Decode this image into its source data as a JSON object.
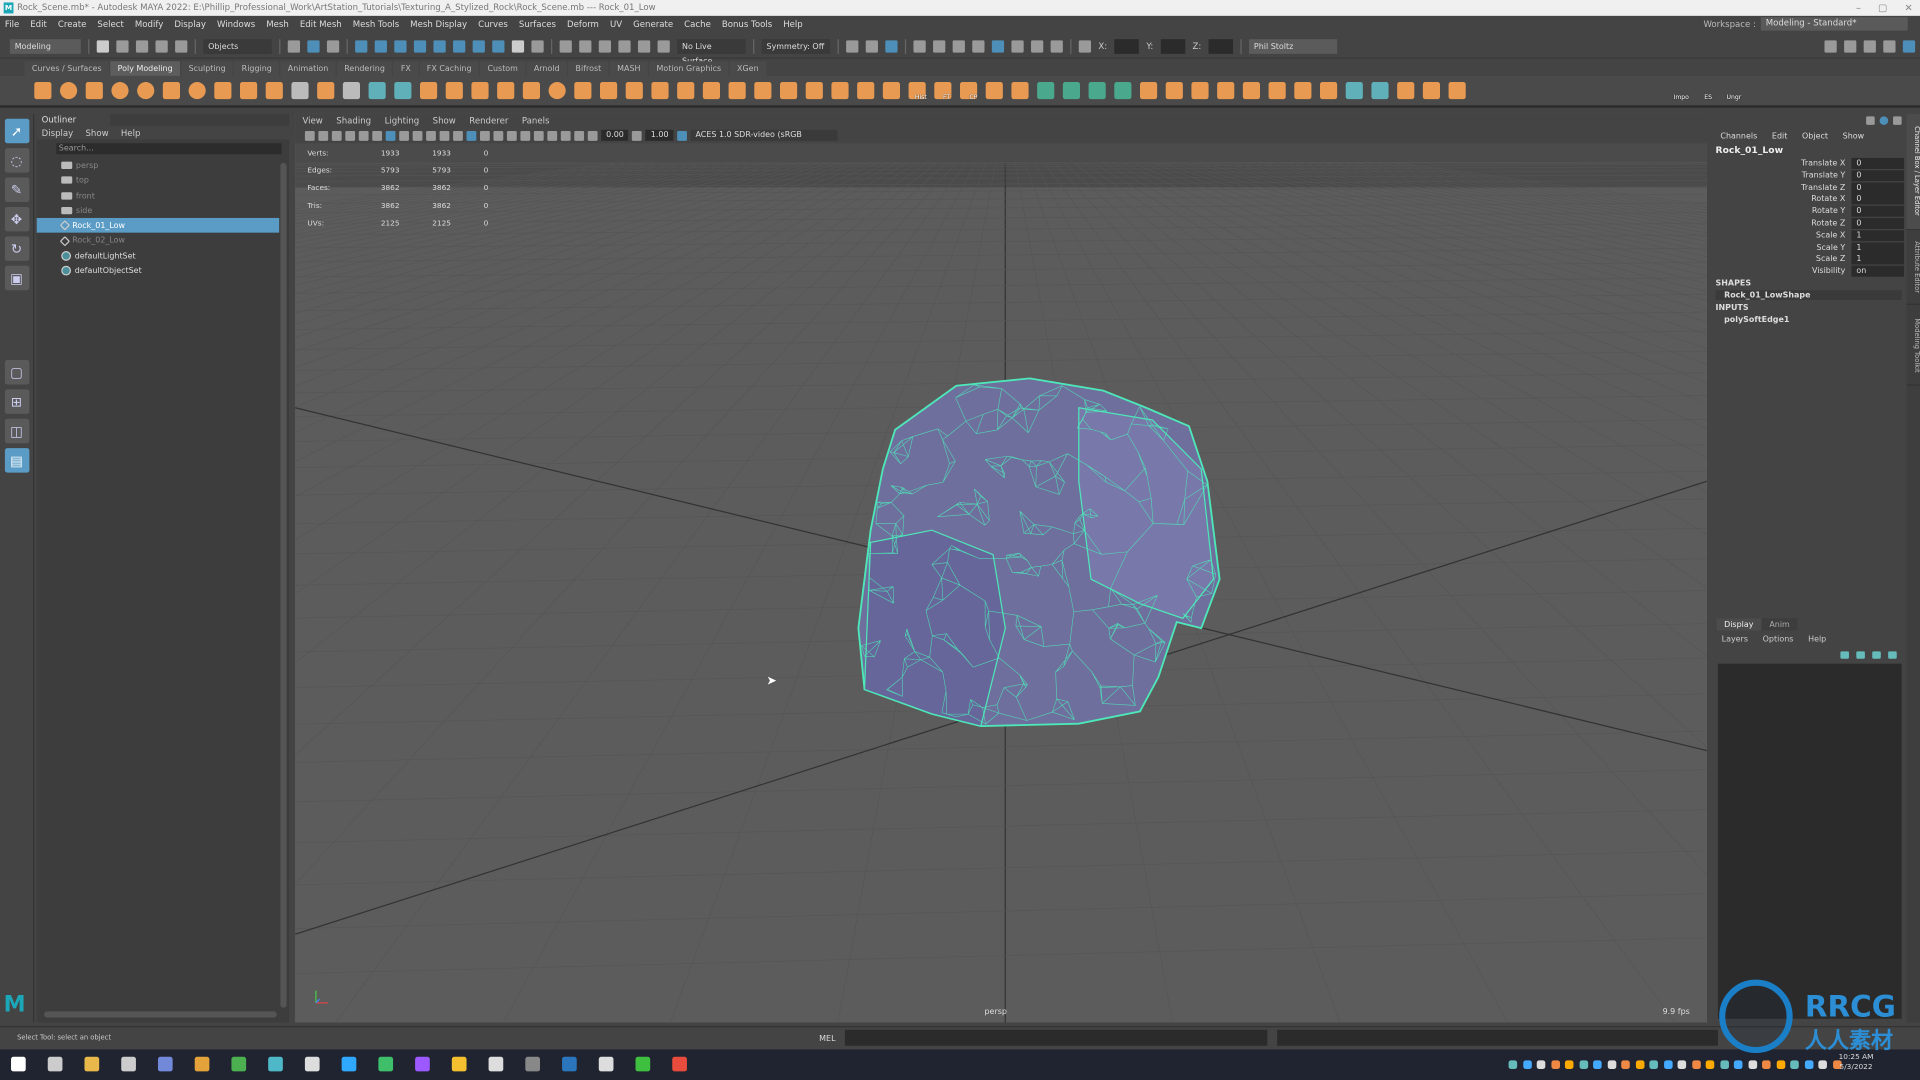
{
  "titlebar": {
    "text": "Rock_Scene.mb* - Autodesk MAYA 2022: E:\\Phillip_Professional_Work\\ArtStation_Tutorials\\Texturing_A_Stylized_Rock\\Rock_Scene.mb  ---  Rock_01_Low",
    "logo": "M",
    "controls": [
      "–",
      "▢",
      "✕"
    ]
  },
  "menubar": [
    "File",
    "Edit",
    "Create",
    "Select",
    "Modify",
    "Display",
    "Windows",
    "Mesh",
    "Edit Mesh",
    "Mesh Tools",
    "Mesh Display",
    "Curves",
    "Surfaces",
    "Deform",
    "UV",
    "Generate",
    "Cache",
    "Bonus Tools",
    "Help"
  ],
  "workspace": {
    "label": "Workspace :",
    "value": "Modeling - Standard*"
  },
  "statusline": {
    "menuset": "Modeling",
    "select_mode": "Objects",
    "live_surface": "No Live Surface",
    "symmetry": "Symmetry: Off",
    "x_label": "X:",
    "y_label": "Y:",
    "z_label": "Z:",
    "user": "Phil Stoltz"
  },
  "shelf": {
    "tabs": [
      "Curves / Surfaces",
      "Poly Modeling",
      "Sculpting",
      "Rigging",
      "Animation",
      "Rendering",
      "FX",
      "FX Caching",
      "Custom",
      "Arnold",
      "Bifrost",
      "MASH",
      "Motion Graphics",
      "XGen"
    ],
    "active": "Poly Modeling",
    "extra_labels": [
      "Hist",
      "FT",
      "CP",
      "Impo",
      "ES",
      "Ungr"
    ]
  },
  "outliner": {
    "title": "Outliner",
    "menu": [
      "Display",
      "Show",
      "Help"
    ],
    "search_placeholder": "Search...",
    "items": [
      {
        "label": "persp",
        "type": "camera",
        "state": "dim"
      },
      {
        "label": "top",
        "type": "camera",
        "state": "dim"
      },
      {
        "label": "front",
        "type": "camera",
        "state": "dim"
      },
      {
        "label": "side",
        "type": "camera",
        "state": "dim"
      },
      {
        "label": "Rock_01_Low",
        "type": "mesh",
        "state": "selected"
      },
      {
        "label": "Rock_02_Low",
        "type": "mesh",
        "state": "dim"
      },
      {
        "label": "defaultLightSet",
        "type": "set",
        "state": "normal"
      },
      {
        "label": "defaultObjectSet",
        "type": "set",
        "state": "normal"
      }
    ]
  },
  "viewport": {
    "menu": [
      "View",
      "Shading",
      "Lighting",
      "Show",
      "Renderer",
      "Panels"
    ],
    "exposure": "0.00",
    "gamma": "1.00",
    "colorspace": "ACES 1.0 SDR-video (sRGB",
    "hud": [
      [
        "Verts:",
        "1933",
        "1933",
        "0"
      ],
      [
        "Edges:",
        "5793",
        "5793",
        "0"
      ],
      [
        "Faces:",
        "3862",
        "3862",
        "0"
      ],
      [
        "Tris:",
        "3862",
        "3862",
        "0"
      ],
      [
        "UVs:",
        "2125",
        "2125",
        "0"
      ]
    ],
    "camera": "persp",
    "fps": "9.9 fps",
    "wire_color": "#4de8b8",
    "mesh_color": "#6f6f9e"
  },
  "channelbox": {
    "menu": [
      "Channels",
      "Edit",
      "Object",
      "Show"
    ],
    "object": "Rock_01_Low",
    "attributes": [
      [
        "Translate X",
        "0"
      ],
      [
        "Translate Y",
        "0"
      ],
      [
        "Translate Z",
        "0"
      ],
      [
        "Rotate X",
        "0"
      ],
      [
        "Rotate Y",
        "0"
      ],
      [
        "Rotate Z",
        "0"
      ],
      [
        "Scale X",
        "1"
      ],
      [
        "Scale Y",
        "1"
      ],
      [
        "Scale Z",
        "1"
      ],
      [
        "Visibility",
        "on"
      ]
    ],
    "shapes_label": "SHAPES",
    "shape": "Rock_01_LowShape",
    "inputs_label": "INPUTS",
    "input": "polySoftEdge1"
  },
  "sidetabs": [
    "Channel Box / Layer Editor",
    "Attribute Editor",
    "Modeling Toolkit"
  ],
  "layer_editor": {
    "tabs": [
      "Display",
      "Anim"
    ],
    "menu": [
      "Layers",
      "Options",
      "Help"
    ]
  },
  "helpline": {
    "text": "Select Tool: select an object",
    "mel": "MEL"
  },
  "taskbar": {
    "time": "10:25 AM",
    "date": "5/3/2022"
  },
  "watermark": {
    "text": "RRCG",
    "subtext": "人人素材"
  }
}
